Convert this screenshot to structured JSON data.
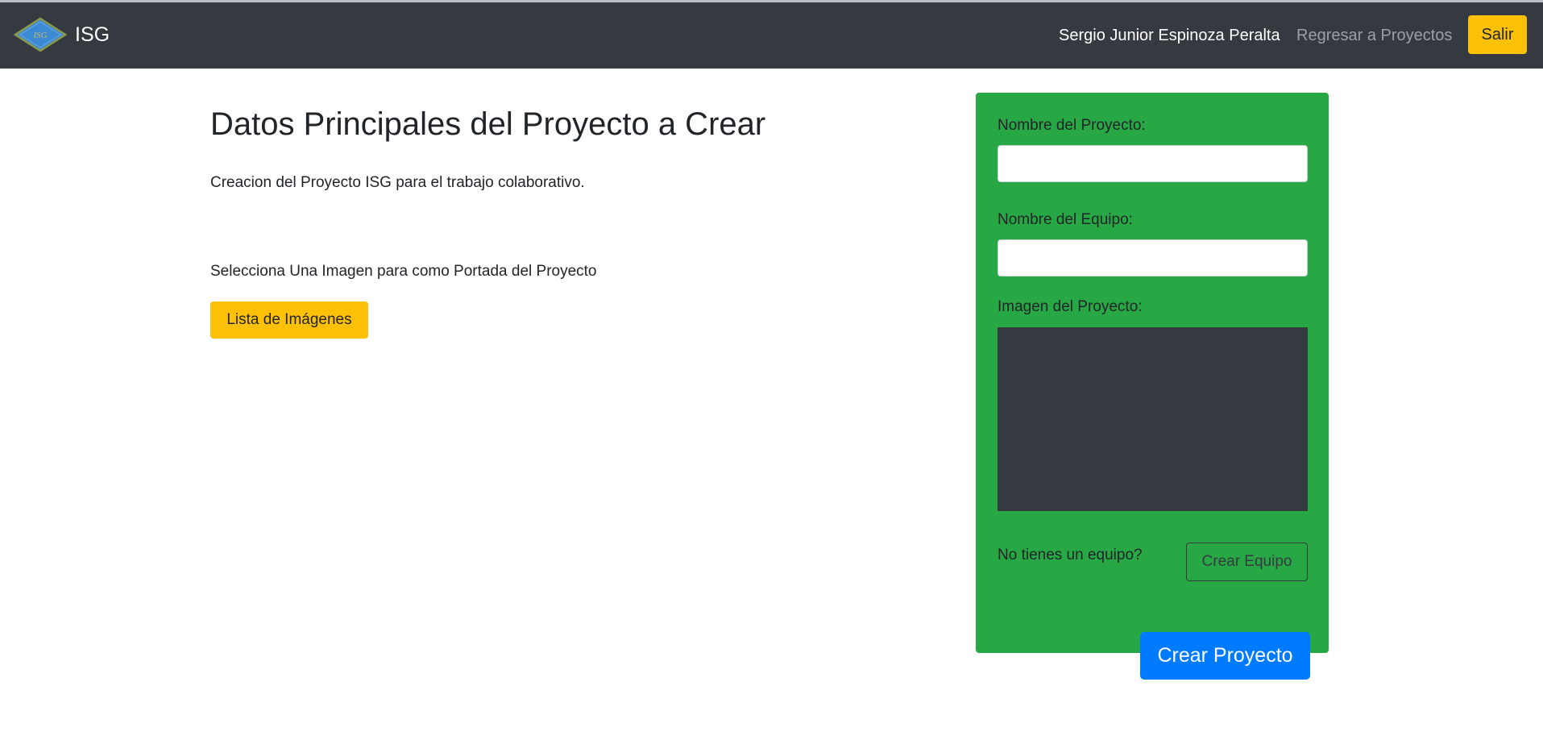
{
  "navbar": {
    "brand_text": "ISG",
    "logo_text": "ISG",
    "user_name": "Sergio Junior Espinoza Peralta",
    "back_link": "Regresar a Proyectos",
    "logout_label": "Salir"
  },
  "main": {
    "title": "Datos Principales del Proyecto a Crear",
    "description": "Creacion del Proyecto ISG para el trabajo colaborativo.",
    "select_image_label": "Selecciona Una Imagen para como Portada del Proyecto",
    "image_list_button": "Lista de Imágenes"
  },
  "form": {
    "project_name_label": "Nombre del Proyecto:",
    "project_name_value": "",
    "team_name_label": "Nombre del Equipo:",
    "team_name_value": "",
    "project_image_label": "Imagen del Proyecto:",
    "no_team_text": "No tienes un equipo?",
    "create_team_button": "Crear Equipo",
    "create_project_button": "Crear Proyecto"
  },
  "colors": {
    "navbar_bg": "#343a40",
    "warning": "#ffc107",
    "panel_green": "#28a745",
    "primary": "#007bff"
  }
}
